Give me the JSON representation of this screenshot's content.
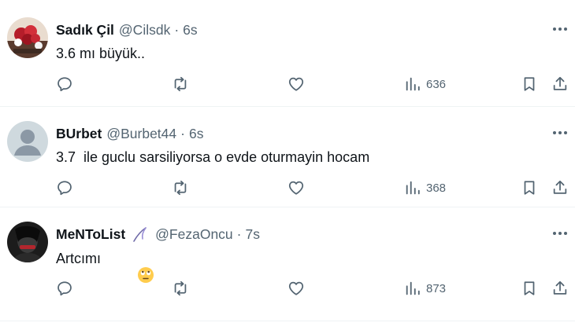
{
  "tweets": [
    {
      "name": "Sadık Çil",
      "handle": "@Cilsdk",
      "separator": "·",
      "time": "6s",
      "text": "3.6 mı büyük..",
      "views": "636",
      "avatar": "photo-flowers-icon"
    },
    {
      "name": "BUrbet",
      "handle": "@Burbet44",
      "separator": "·",
      "time": "6s",
      "text": "3.7  ile guclu sarsiliyorsa o evde oturmayin hocam",
      "views": "368",
      "avatar": "default-profile-icon"
    },
    {
      "name": "MeNToList",
      "handle": "@FezaOncu",
      "separator": "·",
      "time": "7s",
      "text": "Artcımı",
      "views": "873",
      "avatar": "photo-dark-portrait-icon",
      "badge": "scythe-icon",
      "emoji": "face-with-rolling-eyes"
    }
  ],
  "colors": {
    "text_primary": "#0f1419",
    "text_secondary": "#536471",
    "divider": "#eff3f4"
  }
}
